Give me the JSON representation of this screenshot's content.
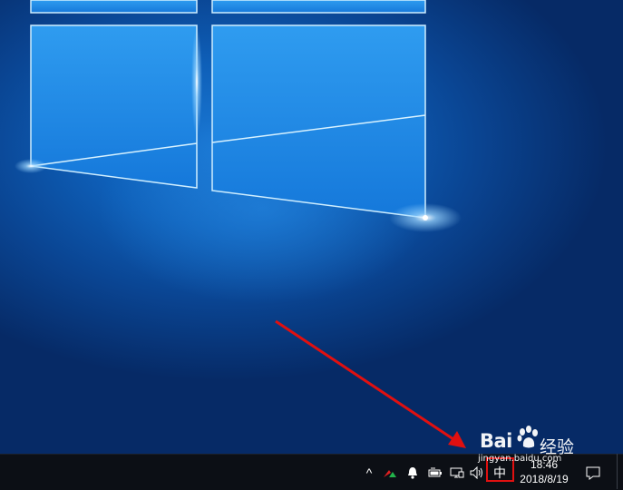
{
  "taskbar": {
    "chevron": "^",
    "ime_label": "中",
    "clock_time": "18:46",
    "clock_date": "2018/8/19"
  },
  "icons": [
    "chevron-up-icon",
    "app-icon",
    "bell-icon",
    "battery-icon",
    "network-icon",
    "volume-icon",
    "notification-icon",
    "windows-logo-icon"
  ],
  "watermark": {
    "brand": "Bai",
    "cn": "经验",
    "url": "jingyan.baidu.com"
  },
  "colors": {
    "wallpaper_blue": "#0e5fb8",
    "taskbar": "#0c0f15",
    "highlight_red": "#e01010"
  }
}
